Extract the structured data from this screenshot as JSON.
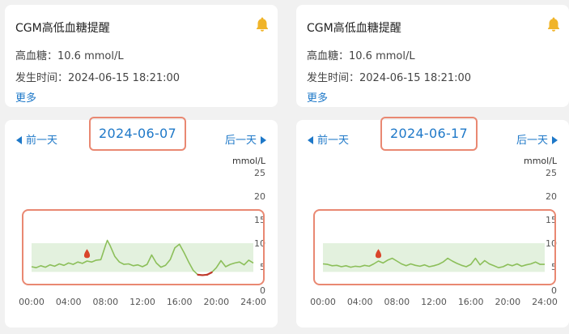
{
  "panels": [
    {
      "alert": {
        "title": "CGM高低血糖提醒",
        "line1": "高血糖：10.6 mmol/L",
        "line2": "发生时间：2024-06-15 18:21:00",
        "more": "更多"
      },
      "nav": {
        "prev": "前一天",
        "next": "后一天",
        "date": "2024-06-07"
      },
      "chart_data": {
        "type": "line",
        "ylabel": "mmol/L",
        "ylim": [
          0,
          25
        ],
        "yticks": [
          "25",
          "20",
          "15",
          "10",
          "5",
          "0"
        ],
        "xticks": [
          "00:00",
          "04:00",
          "08:00",
          "12:00",
          "16:00",
          "20:00",
          "24:00"
        ],
        "xlim": [
          0,
          24
        ],
        "target_range": [
          3.9,
          10.0
        ],
        "series_color": "#8cbf5a",
        "low_color": "#c0392b",
        "marker_hour": 6.0,
        "x": [
          0,
          0.5,
          1,
          1.5,
          2,
          2.5,
          3,
          3.5,
          4,
          4.5,
          5,
          5.5,
          6,
          6.5,
          7,
          7.5,
          8,
          8.2,
          8.5,
          9,
          9.5,
          10,
          10.5,
          11,
          11.5,
          12,
          12.5,
          13,
          13.5,
          14,
          14.5,
          15,
          15.5,
          16,
          16.5,
          17,
          17.5,
          18,
          18.5,
          19,
          19.5,
          20,
          20.5,
          21,
          21.5,
          22,
          22.5,
          23,
          23.5,
          24
        ],
        "y": [
          5.0,
          4.8,
          5.2,
          4.9,
          5.4,
          5.1,
          5.6,
          5.3,
          5.8,
          5.5,
          6.0,
          5.7,
          6.2,
          6.0,
          6.4,
          6.5,
          9.5,
          10.6,
          9.5,
          7.2,
          6.0,
          5.5,
          5.6,
          5.2,
          5.4,
          5.0,
          5.5,
          7.5,
          5.8,
          4.9,
          5.3,
          6.5,
          9.0,
          9.8,
          8.0,
          6.0,
          4.2,
          3.3,
          3.2,
          3.3,
          3.8,
          4.8,
          6.3,
          5.0,
          5.5,
          5.8,
          6.0,
          5.4,
          6.4,
          5.8
        ]
      }
    },
    {
      "alert": {
        "title": "CGM高低血糖提醒",
        "line1": "高血糖：10.6 mmol/L",
        "line2": "发生时间：2024-06-15 18:21:00",
        "more": "更多"
      },
      "nav": {
        "prev": "前一天",
        "next": "后一天",
        "date": "2024-06-17"
      },
      "chart_data": {
        "type": "line",
        "ylabel": "mmol/L",
        "ylim": [
          0,
          25
        ],
        "yticks": [
          "25",
          "20",
          "15",
          "10",
          "5",
          "0"
        ],
        "xticks": [
          "00:00",
          "04:00",
          "08:00",
          "12:00",
          "16:00",
          "20:00",
          "24:00"
        ],
        "xlim": [
          0,
          24
        ],
        "target_range": [
          3.9,
          10.0
        ],
        "series_color": "#8cbf5a",
        "low_color": "#c0392b",
        "marker_hour": 6.0,
        "x": [
          0,
          0.5,
          1,
          1.5,
          2,
          2.5,
          3,
          3.5,
          4,
          4.5,
          5,
          5.5,
          6,
          6.5,
          7,
          7.5,
          8,
          8.5,
          9,
          9.5,
          10,
          10.5,
          11,
          11.5,
          12,
          12.5,
          13,
          13.5,
          14,
          14.5,
          15,
          15.5,
          16,
          16.5,
          17,
          17.5,
          18,
          18.5,
          19,
          19.5,
          20,
          20.5,
          21,
          21.5,
          22,
          22.5,
          23,
          23.5,
          24
        ],
        "y": [
          5.6,
          5.5,
          5.2,
          5.3,
          5.0,
          5.2,
          4.9,
          5.1,
          5.0,
          5.3,
          5.1,
          5.6,
          6.2,
          5.8,
          6.4,
          6.8,
          6.2,
          5.6,
          5.2,
          5.6,
          5.3,
          5.1,
          5.4,
          5.0,
          5.2,
          5.5,
          6.0,
          6.8,
          6.2,
          5.7,
          5.3,
          5.0,
          5.5,
          6.8,
          5.4,
          6.3,
          5.6,
          5.2,
          4.8,
          5.0,
          5.5,
          5.2,
          5.6,
          5.1,
          5.4,
          5.6,
          6.0,
          5.5,
          5.5
        ]
      }
    }
  ]
}
